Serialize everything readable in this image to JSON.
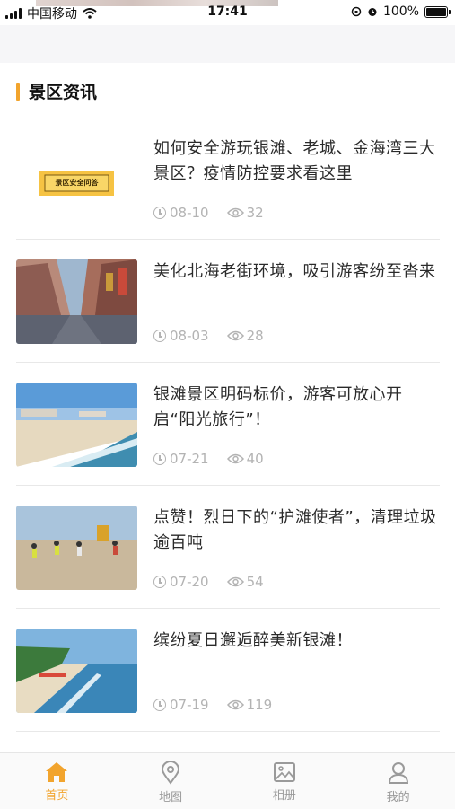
{
  "status_bar": {
    "carrier": "中国移动",
    "time": "17:41",
    "battery": "100%"
  },
  "section": {
    "title": "景区资讯"
  },
  "news": [
    {
      "title": "如何安全游玩银滩、老城、金海湾三大景区？疫情防控要求看这里",
      "date": "08-10",
      "views": "32",
      "badge_text": "景区安全问答"
    },
    {
      "title": "美化北海老街环境，吸引游客纷至沓来",
      "date": "08-03",
      "views": "28"
    },
    {
      "title": "银滩景区明码标价，游客可放心开启“阳光旅行”！",
      "date": "07-21",
      "views": "40"
    },
    {
      "title": "点赞！烈日下的“护滩使者”，清理垃圾逾百吨",
      "date": "07-20",
      "views": "54"
    },
    {
      "title": "缤纷夏日邂逅醉美新银滩！",
      "date": "07-19",
      "views": "119"
    }
  ],
  "tabbar": {
    "items": [
      {
        "label": "首页",
        "icon": "home-icon",
        "active": true
      },
      {
        "label": "地图",
        "icon": "map-pin-icon",
        "active": false
      },
      {
        "label": "相册",
        "icon": "album-icon",
        "active": false
      },
      {
        "label": "我的",
        "icon": "profile-icon",
        "active": false
      }
    ]
  },
  "colors": {
    "accent": "#f2a42d",
    "meta_text": "#b3b3b3",
    "tab_inactive": "#9a9a9a"
  }
}
